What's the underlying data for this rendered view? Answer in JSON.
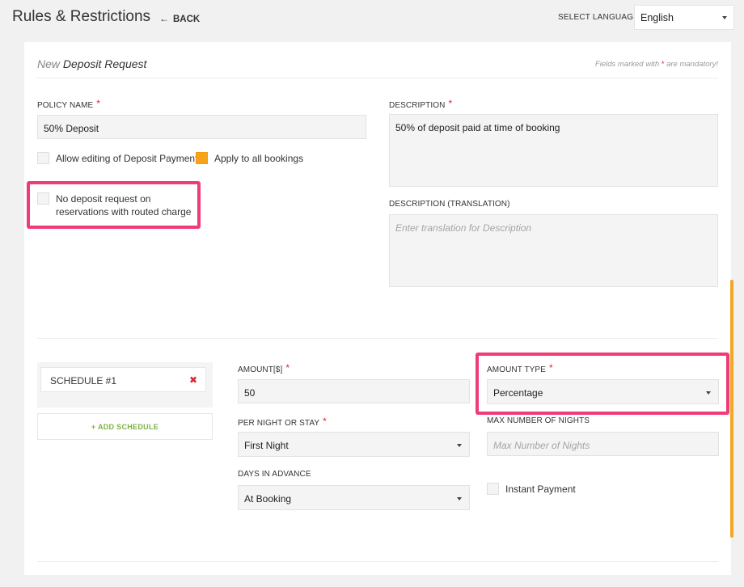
{
  "header": {
    "title": "Rules & Restrictions",
    "back_arrow": "←",
    "back_label": "BACK",
    "language_label": "SELECT LANGUAGE",
    "language_value": "English"
  },
  "form": {
    "title_prefix": "New",
    "title_main": "Deposit Request",
    "mandatory_note_before": "Fields marked with",
    "mandatory_star": "*",
    "mandatory_note_after": "are mandatory!",
    "policy_name_label": "POLICY NAME",
    "policy_name_value": "50% Deposit",
    "allow_editing_label": "Allow editing of Deposit Payment",
    "apply_all_label": "Apply to all bookings",
    "no_deposit_line1": "No deposit request on",
    "no_deposit_line2": "reservations with routed charge",
    "description_label": "DESCRIPTION",
    "description_value": "50% of deposit paid at time of booking",
    "description_translation_label": "DESCRIPTION (TRANSLATION)",
    "description_translation_placeholder": "Enter translation for Description"
  },
  "schedule": {
    "items": [
      {
        "label": "SCHEDULE #1",
        "close_icon": "✖"
      }
    ],
    "add_label": "+ ADD SCHEDULE",
    "amount_label": "AMOUNT[$]",
    "amount_value": "50",
    "amount_type_label": "AMOUNT TYPE",
    "amount_type_value": "Percentage",
    "per_night_label": "PER NIGHT OR STAY",
    "per_night_value": "First Night",
    "max_nights_label": "MAX NUMBER OF NIGHTS",
    "max_nights_placeholder": "Max Number of Nights",
    "days_advance_label": "DAYS IN ADVANCE",
    "days_advance_value": "At Booking",
    "instant_payment_label": "Instant Payment"
  },
  "colors": {
    "required_star": "#e0262f",
    "highlight": "#ef3b76",
    "orange_checkbox": "#f7a21b",
    "add_schedule_text": "#7cb342",
    "scrollbar": "#f5a623"
  },
  "icons": {
    "back": "arrow-left-icon",
    "dropdown": "caret-down-icon",
    "remove": "close-icon"
  }
}
